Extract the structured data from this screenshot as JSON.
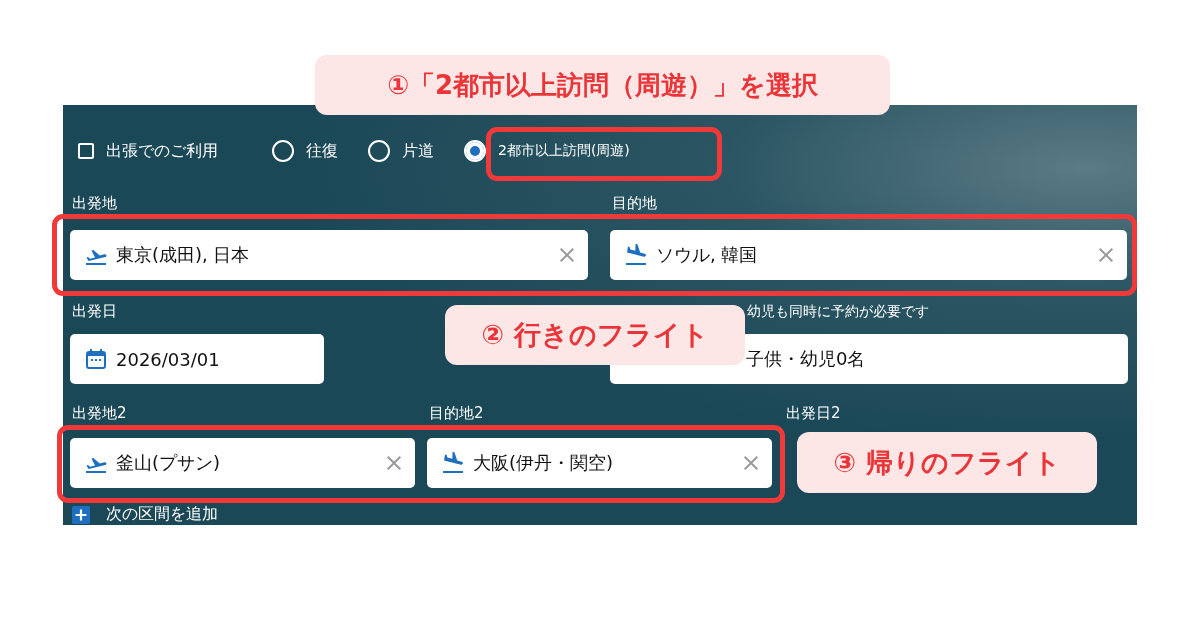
{
  "options": {
    "business": {
      "label": "出張でのご利用",
      "checked": false
    },
    "trip_types": [
      {
        "label": "往復",
        "selected": false
      },
      {
        "label": "片道",
        "selected": false
      },
      {
        "label": "2都市以上訪問(周遊)",
        "selected": true
      }
    ]
  },
  "flight_1": {
    "locations": [
      {
        "kind": "departure",
        "label": "出発地",
        "value": "東京(成田), 日本"
      },
      {
        "kind": "arrival",
        "label": "目的地",
        "value": "ソウル, 韓国"
      }
    ],
    "date": {
      "label": "出発日",
      "value": "2026/03/01"
    },
    "passengers": {
      "note": "幼児も同時に予約が必要です",
      "value": "子供・幼児0名"
    }
  },
  "flight_2": {
    "locations": [
      {
        "kind": "departure",
        "label": "出発地2",
        "value": "釜山(プサン)"
      },
      {
        "kind": "arrival",
        "label": "目的地2",
        "value": "大阪(伊丹・関空)"
      }
    ],
    "date": {
      "label": "出発日2"
    }
  },
  "add_segment": {
    "label": "次の区間を追加"
  },
  "callouts": [
    "①「2都市以上訪問（周遊）」を選択",
    "② 行きのフライト",
    "③ 帰りのフライト"
  ]
}
